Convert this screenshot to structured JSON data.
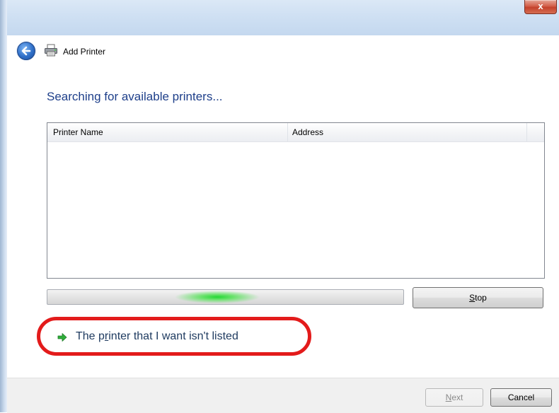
{
  "window": {
    "title": "Add Printer",
    "close_glyph": "x"
  },
  "nav": {
    "back_icon": "back-arrow-icon",
    "printer_icon": "printer-icon"
  },
  "main": {
    "heading": "Searching for available printers...",
    "columns": [
      "Printer Name",
      "Address"
    ],
    "printers": [],
    "stop_button": {
      "mnemonic": "S",
      "rest": "top"
    },
    "link": {
      "pre": "The p",
      "mnemonic": "r",
      "post": "inter that I want isn't listed",
      "icon": "green-arrow-icon"
    },
    "highlight_color": "#e31b1b"
  },
  "footer": {
    "next_button": {
      "mnemonic": "N",
      "rest": "ext",
      "enabled": false
    },
    "cancel_button": "Cancel"
  },
  "colors": {
    "heading": "#1e3f8a",
    "titlebar": "#cfe0f3",
    "progress_glow": "#22d833"
  }
}
